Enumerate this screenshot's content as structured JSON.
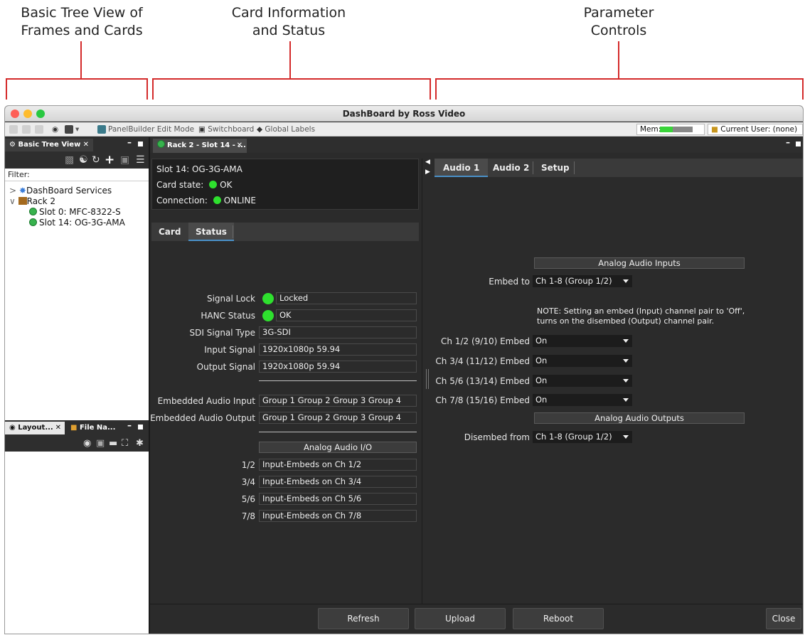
{
  "callouts": {
    "left": [
      "Basic Tree View of",
      "Frames and Cards"
    ],
    "center": [
      "Card Information",
      "and Status"
    ],
    "right": [
      "Parameter",
      "Controls"
    ]
  },
  "window": {
    "title": "DashBoard by Ross Video"
  },
  "toolbar": {
    "panelbuilder_label": "PanelBuilder Edit Mode",
    "switchboard_label": "Switchboard",
    "global_labels_label": "Global Labels",
    "mem_label": "Mem:",
    "current_user_label": "Current User: (none)"
  },
  "tree_panel": {
    "tab_title": "Basic Tree View",
    "filter_label": "Filter:",
    "items": [
      {
        "label": "DashBoard Services"
      },
      {
        "label": "Rack 2"
      },
      {
        "label": "Slot 0: MFC-8322-S"
      },
      {
        "label": "Slot 14: OG-3G-AMA"
      }
    ]
  },
  "lower_panel": {
    "tab1_title": "Layout...",
    "tab2_title": "File Na..."
  },
  "card_tab": {
    "title": "Rack 2 - Slot 14 - ..."
  },
  "card_info": {
    "slot": "Slot 14: OG-3G-AMA",
    "card_state_label": "Card state:",
    "card_state_value": "OK",
    "connection_label": "Connection:",
    "connection_value": "ONLINE"
  },
  "status_tabs": [
    "Card",
    "Status"
  ],
  "status": {
    "signal_lock_label": "Signal Lock",
    "signal_lock_value": "Locked",
    "hanc_label": "HANC Status",
    "hanc_value": "OK",
    "sdi_type_label": "SDI Signal Type",
    "sdi_type_value": "3G-SDI",
    "input_signal_label": "Input Signal",
    "input_signal_value": "1920x1080p 59.94",
    "output_signal_label": "Output Signal",
    "output_signal_value": "1920x1080p 59.94",
    "emb_in_label": "Embedded Audio Input",
    "emb_in_value": "Group 1 Group 2 Group 3 Group 4",
    "emb_out_label": "Embedded Audio Output",
    "emb_out_value": "Group 1 Group 2 Group 3 Group 4",
    "analog_io_header": "Analog Audio I/O",
    "io_rows": [
      {
        "ch": "1/2",
        "value": "Input-Embeds on Ch 1/2"
      },
      {
        "ch": "3/4",
        "value": "Input-Embeds on Ch 3/4"
      },
      {
        "ch": "5/6",
        "value": "Input-Embeds on Ch 5/6"
      },
      {
        "ch": "7/8",
        "value": "Input-Embeds on Ch 7/8"
      }
    ]
  },
  "param_tabs": [
    "Audio 1",
    "Audio 2",
    "Setup"
  ],
  "params": {
    "inputs_header": "Analog Audio Inputs",
    "embed_to_label": "Embed to",
    "embed_to_value": "Ch 1-8  (Group 1/2)",
    "note_line1": "NOTE: Setting an embed (Input) channel pair to 'Off',",
    "note_line2": "turns on the disembed (Output) channel pair.",
    "embeds": [
      {
        "label": "Ch 1/2 (9/10) Embed",
        "value": "On"
      },
      {
        "label": "Ch 3/4 (11/12) Embed",
        "value": "On"
      },
      {
        "label": "Ch 5/6 (13/14) Embed",
        "value": "On"
      },
      {
        "label": "Ch 7/8 (15/16) Embed",
        "value": "On"
      }
    ],
    "outputs_header": "Analog Audio Outputs",
    "disembed_label": "Disembed from",
    "disembed_value": "Ch 1-8  (Group 1/2)"
  },
  "buttons": {
    "refresh": "Refresh",
    "upload": "Upload",
    "reboot": "Reboot",
    "close": "Close"
  },
  "colors": {
    "accent": "#4a90c8",
    "status_ok": "#2ee02e",
    "callout_red": "#d42a2a"
  }
}
